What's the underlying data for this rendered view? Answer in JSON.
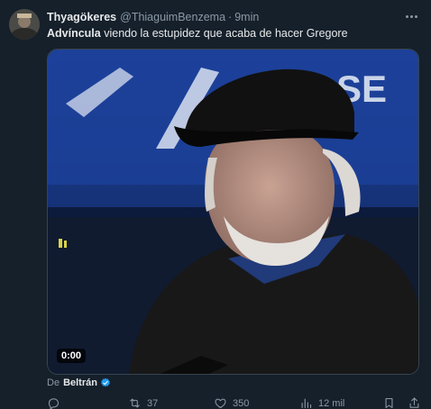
{
  "tweet": {
    "author": {
      "display_name": "Thyagökeres",
      "handle": "@ThiaguimBenzema",
      "time": "9min"
    },
    "text": {
      "mention": "Advíncula",
      "rest": " viendo la estupidez que acaba de hacer Gregore"
    },
    "media": {
      "duration": "0:00"
    },
    "source": {
      "prefix": "De",
      "name": "Beltrán"
    },
    "actions": {
      "replies": "",
      "retweets": "37",
      "likes": "350",
      "views": "12 mil"
    }
  },
  "colors": {
    "background": "#15202b",
    "accent": "#1d9bf0",
    "muted_text": "#8b98a5"
  }
}
